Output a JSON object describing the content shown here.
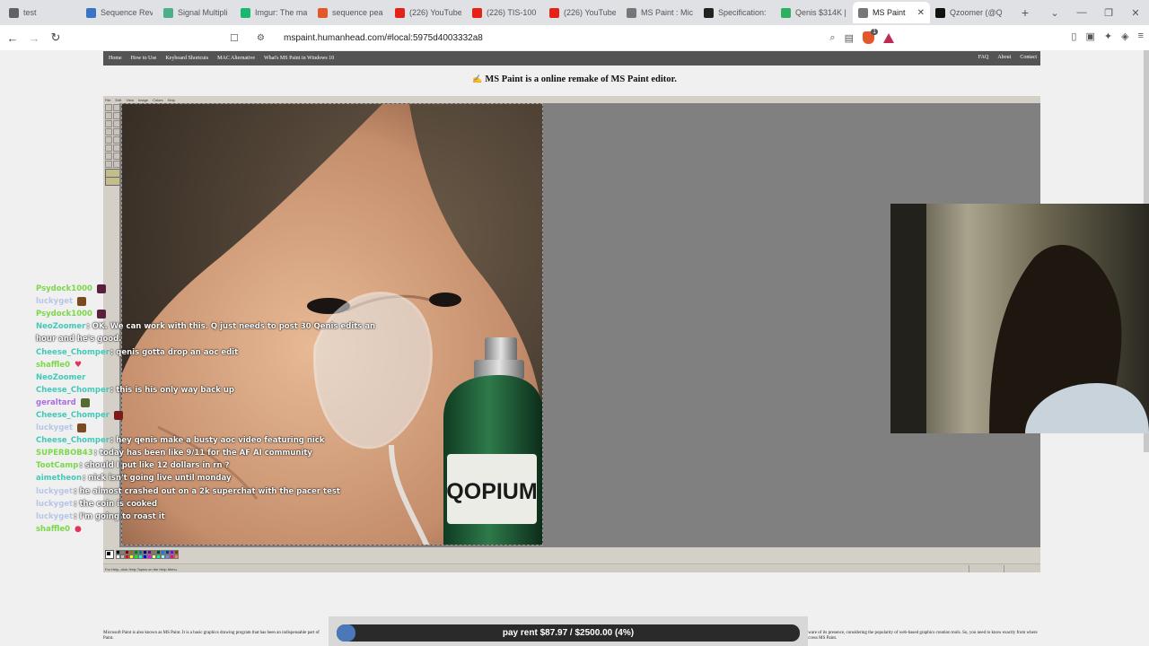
{
  "browser": {
    "tabs": [
      {
        "label": "test",
        "color": "#5f6368"
      },
      {
        "label": "Sequence Reve",
        "color": "#3a74c4"
      },
      {
        "label": "Signal Multipli",
        "color": "#4caf87"
      },
      {
        "label": "Imgur: The ma",
        "color": "#1bb76e"
      },
      {
        "label": "sequence pea",
        "color": "#e2582b"
      },
      {
        "label": "(226) YouTube",
        "color": "#e62117"
      },
      {
        "label": "(226) TIS-100",
        "color": "#e62117"
      },
      {
        "label": "(226) YouTube",
        "color": "#e62117"
      },
      {
        "label": "MS Paint : Mic",
        "color": "#777777"
      },
      {
        "label": "Specification:",
        "color": "#222222"
      },
      {
        "label": "Qenis $314K |",
        "color": "#2fb060"
      },
      {
        "label": "MS Paint",
        "color": "#777777",
        "active": true
      },
      {
        "label": "Qzoomer (@Q",
        "color": "#111111"
      }
    ],
    "new_tab_symbol": "+",
    "url": "mspaint.humanhead.com/#local:5975d4003332a8",
    "brave_badge": "1"
  },
  "site": {
    "nav_left": [
      "Home",
      "How to Use",
      "Keyboard Shortcuts",
      "MAC Alternative",
      "What's MS Paint in Windows 10"
    ],
    "nav_right": [
      "FAQ",
      "About",
      "Contact"
    ],
    "headline": "MS Paint is a online remake of MS Paint editor.",
    "bottom_text_left": "Microsoft Paint is also known as MS Paint. It is a basic graphics drawing program that has been an indispensable part of",
    "bottom_text_right": "unaware of its presence, considering the popularity of web-based graphics creation tools. So, you need to know exactly from where to access MS Paint.",
    "bottom_text_left_2": "Paint."
  },
  "paint": {
    "menu": [
      "File",
      "Edit",
      "View",
      "Image",
      "Colors",
      "Help"
    ],
    "status": "For Help, click Help Topics on the Help Menu.",
    "canvas_label": "QOPIUM",
    "palette": [
      "#000000",
      "#808080",
      "#800000",
      "#808000",
      "#008000",
      "#008080",
      "#000080",
      "#800080",
      "#808040",
      "#004040",
      "#0080ff",
      "#004080",
      "#8000ff",
      "#804000",
      "#ffffff",
      "#c0c0c0",
      "#ff0000",
      "#ffff00",
      "#00ff00",
      "#00ffff",
      "#0000ff",
      "#ff00ff",
      "#ffff80",
      "#00ff80",
      "#80ffff",
      "#8080ff",
      "#ff0080",
      "#ff8040"
    ]
  },
  "chat": [
    {
      "user": "Psydock1000",
      "color": "#7bd84a",
      "message": "",
      "badge": "#5a1f3f"
    },
    {
      "user": "luckyget",
      "color": "#b7c6e6",
      "message": "",
      "badge": "#7a4a20"
    },
    {
      "user": "Psydock1000",
      "color": "#7bd84a",
      "message": "",
      "badge": "#5a1f3f"
    },
    {
      "user": "NeoZoomer",
      "color": "#43c9b8",
      "message": ": OK. We can work with this. Q just needs to post 30 Qenis edits an"
    },
    {
      "user": "",
      "color": "#b7c6e6",
      "message": "hour and he's good."
    },
    {
      "user": "Cheese_Chomper",
      "color": "#43c9b8",
      "message": ": qenis gotta drop an aoc edit"
    },
    {
      "user": "shaffle0",
      "color": "#7bd84a",
      "message": "",
      "emoji": "♥"
    },
    {
      "user": "NeoZoomer",
      "color": "#43c9b8",
      "message": ""
    },
    {
      "user": "Cheese_Chomper",
      "color": "#43c9b8",
      "message": ": this is his only way back up"
    },
    {
      "user": "geraltard",
      "color": "#a86ee0",
      "message": "",
      "badge": "#556b2f"
    },
    {
      "user": "Cheese_Chomper",
      "color": "#43c9b8",
      "message": "",
      "badge": "#7a1a1a"
    },
    {
      "user": "luckyget",
      "color": "#b7c6e6",
      "message": "",
      "badge": "#7a4a20"
    },
    {
      "user": "Cheese_Chomper",
      "color": "#43c9b8",
      "message": ": hey qenis make a busty aoc video featuring nick"
    },
    {
      "user": "SUPERBOB43",
      "color": "#7bd84a",
      "message": ": today has been like 9/11 for the AF AI community"
    },
    {
      "user": "TootCamp",
      "color": "#7bd84a",
      "message": ": should I put like 12 dollars in rn ?"
    },
    {
      "user": "aimetheon",
      "color": "#43c9b8",
      "message": ": nick isn't going live until monday"
    },
    {
      "user": "luckyget",
      "color": "#b7c6e6",
      "message": ": he almost crashed out on a 2k superchat with the pacer test"
    },
    {
      "user": "luckyget",
      "color": "#b7c6e6",
      "message": ": the coin is cooked"
    },
    {
      "user": "luckyget",
      "color": "#b7c6e6",
      "message": ": I'm going to roast it"
    },
    {
      "user": "shaffle0",
      "color": "#7bd84a",
      "message": "",
      "emoji": "●"
    }
  ],
  "goal": {
    "label": "pay rent $87.97 / $2500.00 (4%)",
    "progress": 0.04
  }
}
